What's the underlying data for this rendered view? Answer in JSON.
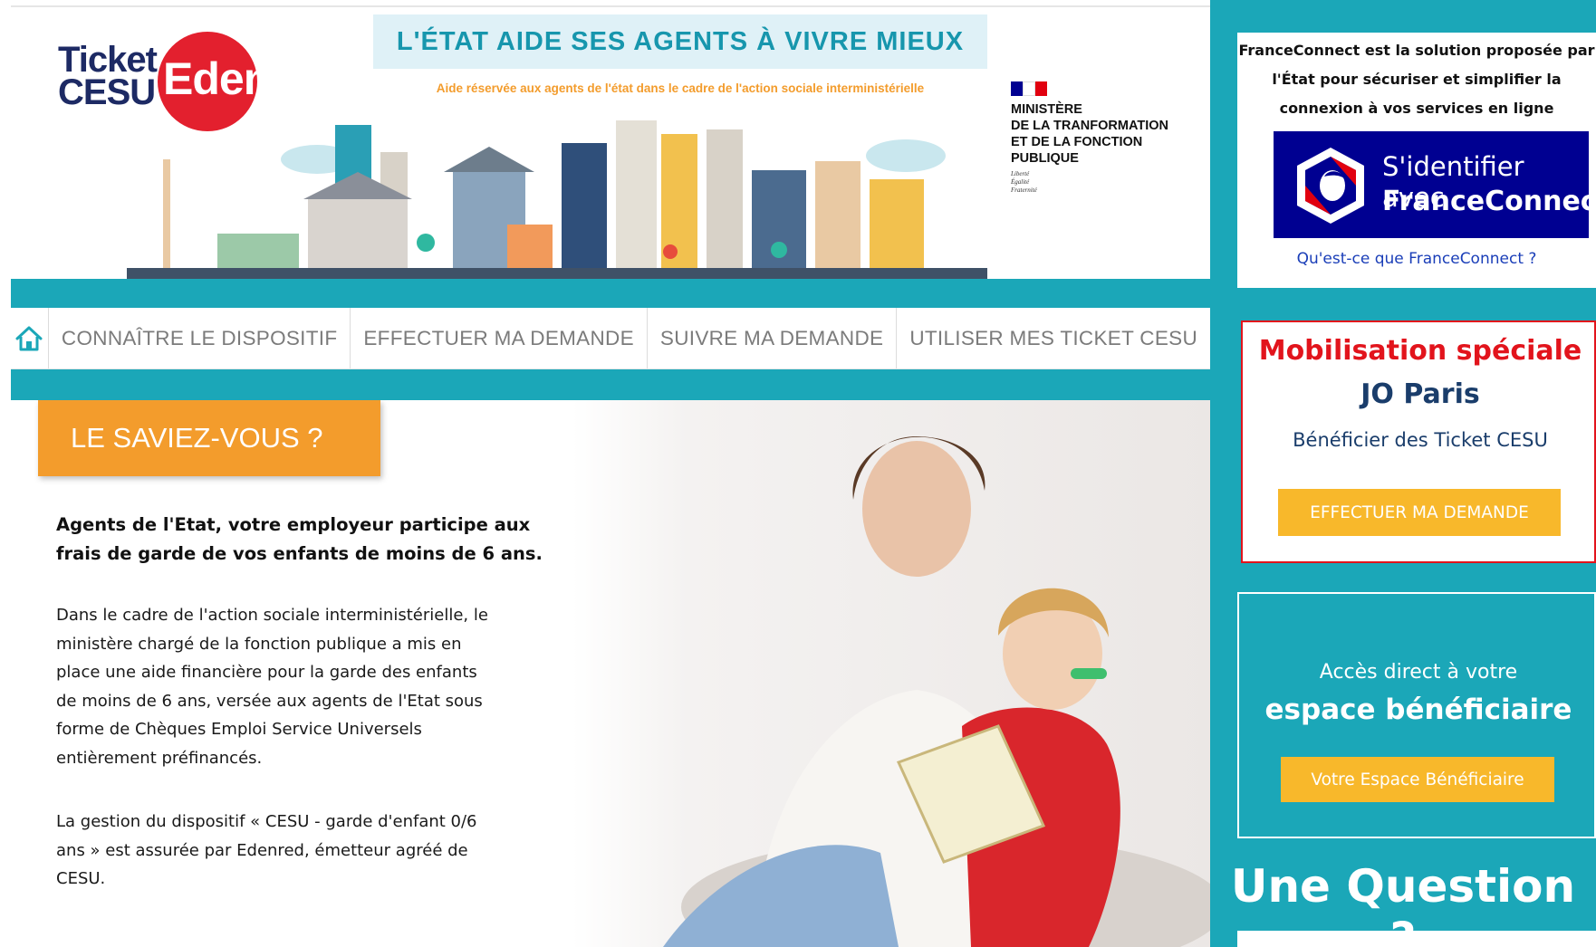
{
  "header": {
    "logo": {
      "line1": "Ticket",
      "line2": "CESU",
      "brand": "Edenred"
    },
    "banner": {
      "title": "L'ÉTAT AIDE SES AGENTS À VIVRE MIEUX",
      "subtitle": "Aide réservée aux agents de l'état dans le cadre de l'action sociale interministérielle"
    },
    "ministere": {
      "line1": "MINISTÈRE",
      "line2": "DE LA TRANFORMATION",
      "line3": "ET DE LA FONCTION",
      "line4": "PUBLIQUE",
      "devise1": "Liberté",
      "devise2": "Égalité",
      "devise3": "Fraternité"
    }
  },
  "nav": {
    "home_icon": "home-icon",
    "items": [
      {
        "label": "CONNAÎTRE LE DISPOSITIF"
      },
      {
        "label": "EFFECTUER MA DEMANDE"
      },
      {
        "label": "SUIVRE MA DEMANDE"
      },
      {
        "label": "UTILISER MES TICKET CESU"
      }
    ]
  },
  "main": {
    "saviez_title": "LE SAVIEZ-VOUS ?",
    "lead_line1": "Agents de l'Etat, votre employeur participe aux",
    "lead_line2": "frais de garde de vos enfants de moins de 6 ans.",
    "para1_lines": [
      "Dans le cadre de l'action sociale interministérielle, le",
      "ministère chargé de la fonction publique a mis en",
      "place une aide financière pour la garde des enfants",
      "de moins de 6 ans, versée aux agents de l'Etat sous",
      "forme de Chèques Emploi Service Universels",
      "entièrement préfinancés."
    ],
    "para2_lines": [
      "La gestion du dispositif « CESU - garde d'enfant 0/6",
      "ans » est assurée par Edenred, émetteur agréé de",
      "CESU."
    ]
  },
  "sidebar": {
    "franceconnect": {
      "text_lines": [
        "FranceConnect est la solution proposée par",
        "l'État pour sécuriser et simplifier la",
        "connexion à vos services en ligne"
      ],
      "button_line1": "S'identifier avec",
      "button_line2": "FranceConnect",
      "link": "Qu'est-ce que FranceConnect ?"
    },
    "mobilisation": {
      "title": "Mobilisation spéciale",
      "subtitle": "JO Paris",
      "text": "Bénéficier des Ticket CESU",
      "button": "EFFECTUER MA DEMANDE"
    },
    "beneficiaire": {
      "line1": "Accès direct à votre",
      "line2": "espace bénéficiaire",
      "button": "Votre Espace Bénéficiaire"
    },
    "question": "Une Question ?"
  },
  "colors": {
    "teal": "#1ba7b8",
    "orange": "#f39c2c",
    "button_yellow": "#f8b82b",
    "franceconnect_blue": "#000091",
    "alert_red": "#e2141c",
    "edenred_red": "#e3202e",
    "navy": "#1d2a64"
  }
}
